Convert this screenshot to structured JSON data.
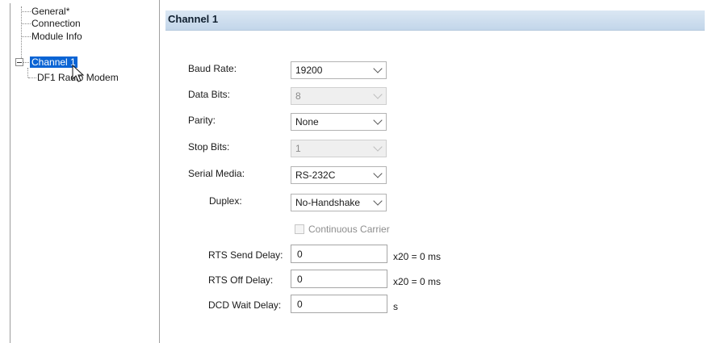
{
  "tree": {
    "items": [
      {
        "label": "General*"
      },
      {
        "label": "Connection"
      },
      {
        "label": "Module Info"
      },
      {
        "label": "Channel 1"
      },
      {
        "label": "DF1 Radio Modem"
      }
    ]
  },
  "header": {
    "title": "Channel 1"
  },
  "form": {
    "baud_rate": {
      "label": "Baud Rate:",
      "value": "19200"
    },
    "data_bits": {
      "label": "Data Bits:",
      "value": "8"
    },
    "parity": {
      "label": "Parity:",
      "value": "None"
    },
    "stop_bits": {
      "label": "Stop Bits:",
      "value": "1"
    },
    "serial_media": {
      "label": "Serial Media:",
      "value": "RS-232C"
    },
    "duplex": {
      "label": "Duplex:",
      "value": "No-Handshake"
    },
    "continuous_carrier": {
      "label": "Continuous Carrier",
      "checked": false
    },
    "rts_send_delay": {
      "label": "RTS Send Delay:",
      "value": "0",
      "unit": "x20 = 0 ms"
    },
    "rts_off_delay": {
      "label": "RTS Off Delay:",
      "value": "0",
      "unit": "x20 = 0 ms"
    },
    "dcd_wait_delay": {
      "label": "DCD Wait Delay:",
      "value": "0",
      "unit": "s"
    }
  },
  "colors": {
    "selection": "#0a64d4",
    "header_gradient_top": "#dbe7f3",
    "header_gradient_bottom": "#c3d6ea"
  }
}
